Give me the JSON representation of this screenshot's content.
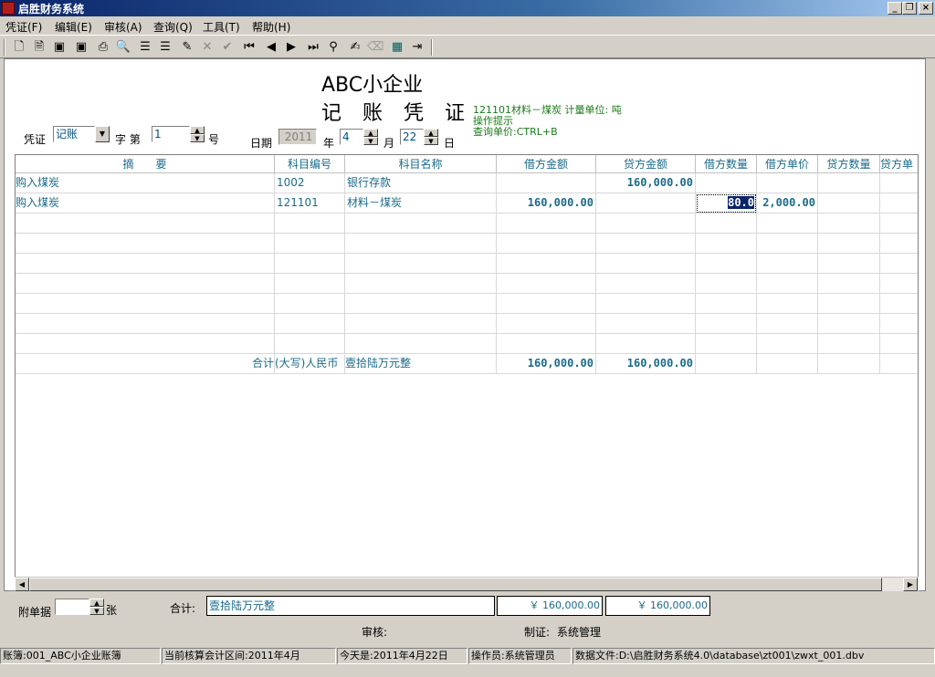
{
  "window": {
    "title": "启胜财务系统"
  },
  "menu": [
    "凭证(F)",
    "编辑(E)",
    "审核(A)",
    "查询(Q)",
    "工具(T)",
    "帮助(H)"
  ],
  "header": {
    "company": "ABC小企业",
    "voucher_title": "记 账 凭 证",
    "info_line1": "121101材料－煤炭  计量单位: 吨",
    "info_line2": "操作提示",
    "info_line3": "查询单价:CTRL+B",
    "voucher_label": "凭证",
    "voucher_type": "记账",
    "zi_label": "字 第",
    "voucher_no": "1",
    "hao_label": "号",
    "date_label": "日期",
    "year": "2011",
    "year_label": "年",
    "month": "4",
    "month_label": "月",
    "day": "22",
    "day_label": "日"
  },
  "grid": {
    "columns": [
      "摘　　要",
      "科目编号",
      "科目名称",
      "借方金额",
      "贷方金额",
      "借方数量",
      "借方单价",
      "贷方数量",
      "贷方单"
    ],
    "rows": [
      {
        "summary": "购入煤炭",
        "code": "1002",
        "name": "银行存款",
        "debit": "",
        "credit": "160,000.00",
        "dqty": "",
        "dprice": "",
        "cqty": ""
      },
      {
        "summary": "购入煤炭",
        "code": "121101",
        "name": "材料－煤炭",
        "debit": "160,000.00",
        "credit": "",
        "dqty": "80.0",
        "dprice": "2,000.00",
        "cqty": ""
      }
    ],
    "total_label": "合计",
    "total_caps_label": "(大写)人民币",
    "total_caps": "壹拾陆万元整",
    "total_debit": "160,000.00",
    "total_credit": "160,000.00"
  },
  "footer": {
    "attach_label": "附单据",
    "attach_unit": "张",
    "total_label": "合计:",
    "total_caps": "壹拾陆万元整",
    "total_debit": "￥ 160,000.00",
    "total_credit": "￥ 160,000.00",
    "audit_label": "审核:",
    "maker_label": "制证:",
    "maker": "系统管理"
  },
  "status": {
    "book": "账簿:001_ABC小企业账簿",
    "period": "当前核算会计区间:2011年4月",
    "today": "今天是:2011年4月22日",
    "operator": "操作员:系统管理员",
    "datafile": "数据文件:D:\\启胜财务系统4.0\\database\\zt001\\zwxt_001.dbv"
  }
}
